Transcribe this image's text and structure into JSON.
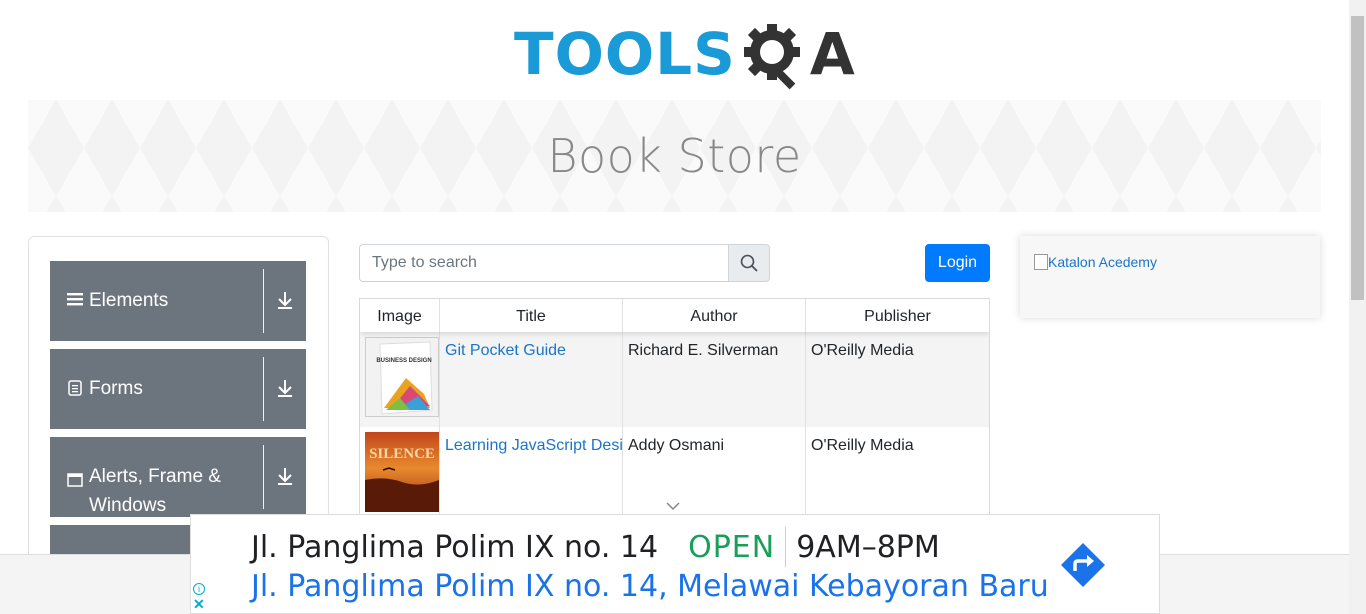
{
  "header": {
    "logo_tools": "TOOLS",
    "logo_qa": "A",
    "brand_color": "#1a9ad6"
  },
  "banner": {
    "title": "Book Store"
  },
  "sidebar": {
    "groups": [
      {
        "label": "Elements",
        "icon": "menu-icon"
      },
      {
        "label": "Forms",
        "icon": "form-icon"
      },
      {
        "label": "Alerts, Frame &",
        "label2": "Windows",
        "icon": "window-icon"
      }
    ]
  },
  "search": {
    "placeholder": "Type to search"
  },
  "login": {
    "label": "Login",
    "color": "#007bff"
  },
  "table": {
    "headers": [
      "Image",
      "Title",
      "Author",
      "Publisher"
    ],
    "rows": [
      {
        "title": "Git Pocket Guide",
        "author": "Richard E. Silverman",
        "publisher": "O'Reilly Media",
        "cover_text": "BUSINESS DESIGN"
      },
      {
        "title": "Learning JavaScript Design Patterns",
        "author": "Addy Osmani",
        "publisher": "O'Reilly Media",
        "cover_text": "SILENCE"
      }
    ]
  },
  "right_ad": {
    "alt": "Katalon Acedemy"
  },
  "bottom_ad": {
    "address": "Jl. Panglima Polim IX no. 14",
    "status": "OPEN",
    "hours": "9AM–8PM",
    "full_address": "Jl. Panglima Polim IX no. 14, Melawai Kebayoran Baru",
    "info": "i",
    "close": "✕"
  }
}
